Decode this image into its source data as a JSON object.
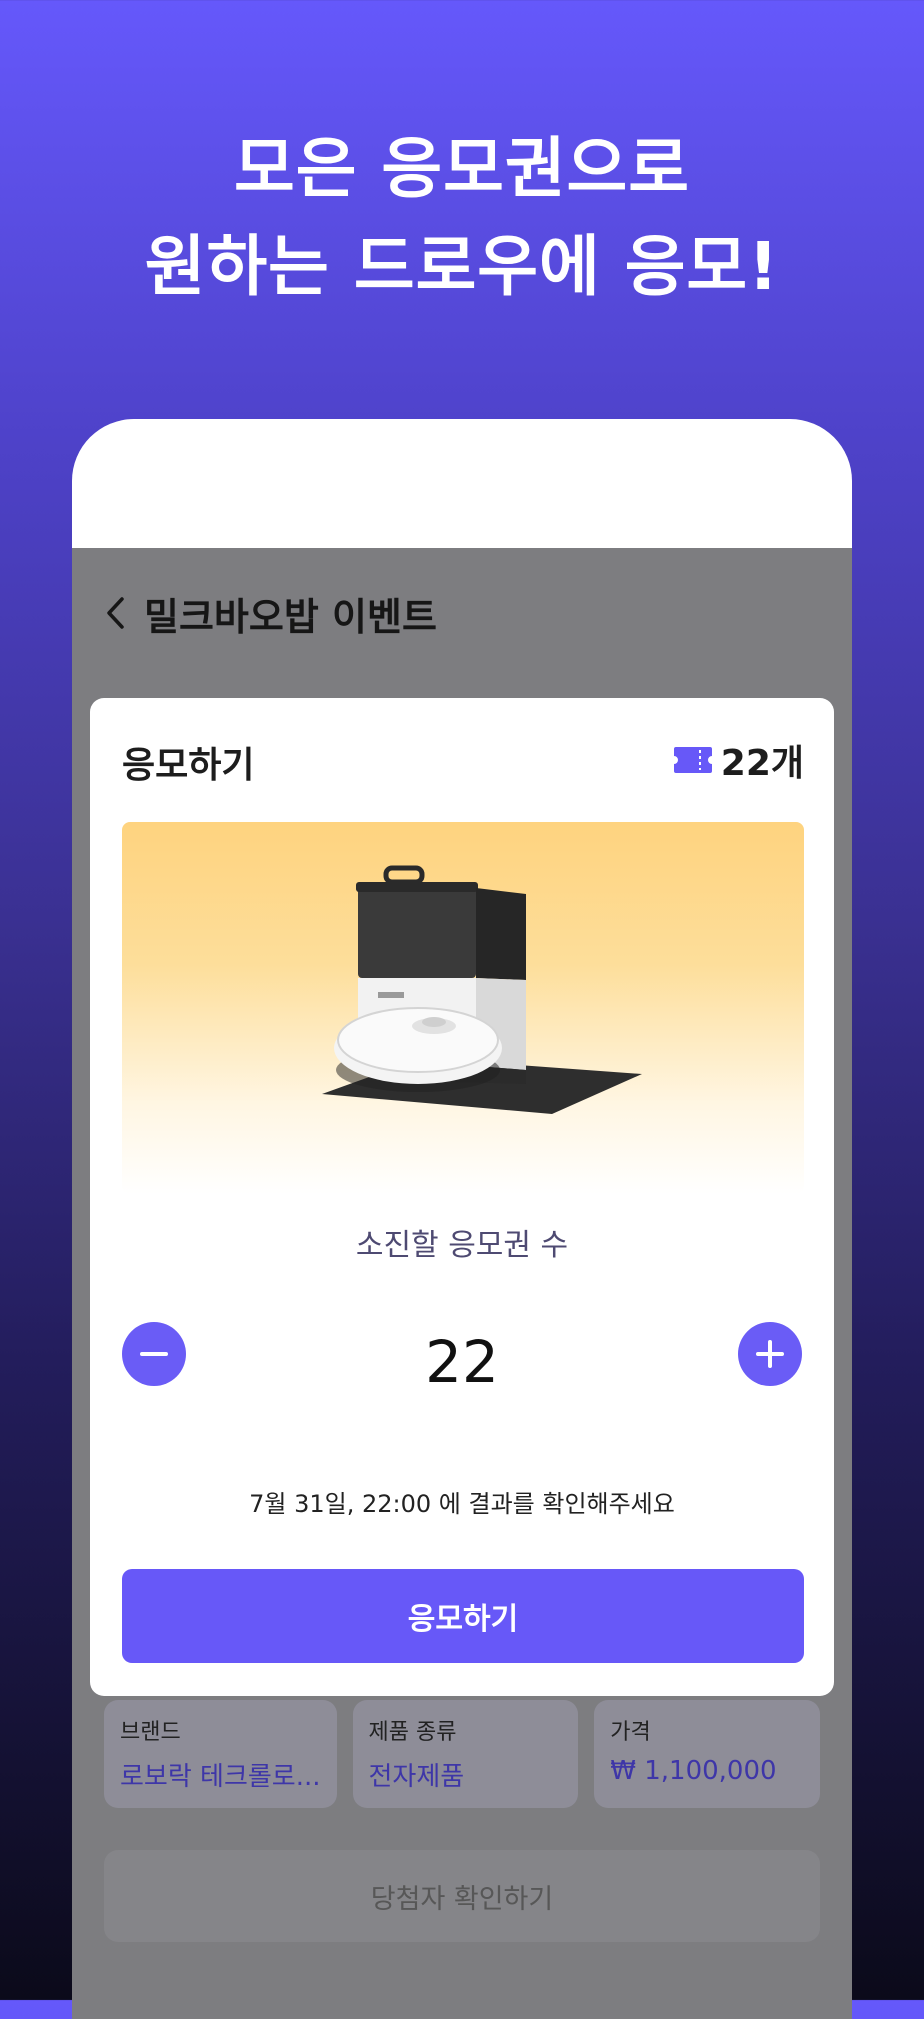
{
  "promo": {
    "line1": "모은 응모권으로",
    "line2": "원하는 드로우에 응모!"
  },
  "header": {
    "back_icon": "chevron-left-icon",
    "title": "밀크바오밥 이벤트"
  },
  "modal": {
    "title": "응모하기",
    "ticket_icon": "ticket-icon",
    "ticket_count": "22개",
    "consume_label": "소진할 응모권 수",
    "entry_count": "22",
    "minus_icon": "minus-icon",
    "plus_icon": "plus-icon",
    "result_notice": "7월 31일, 22:00 에 결과를 확인해주세요",
    "apply_label": "응모하기"
  },
  "info": [
    {
      "label": "브랜드",
      "value": "로보락 테크롤로..."
    },
    {
      "label": "제품 종류",
      "value": "전자제품"
    },
    {
      "label": "가격",
      "value": "₩ 1,100,000"
    }
  ],
  "winners_label": "당첨자 확인하기",
  "colors": {
    "accent": "#6758f8",
    "info_value": "#3e36a8"
  }
}
